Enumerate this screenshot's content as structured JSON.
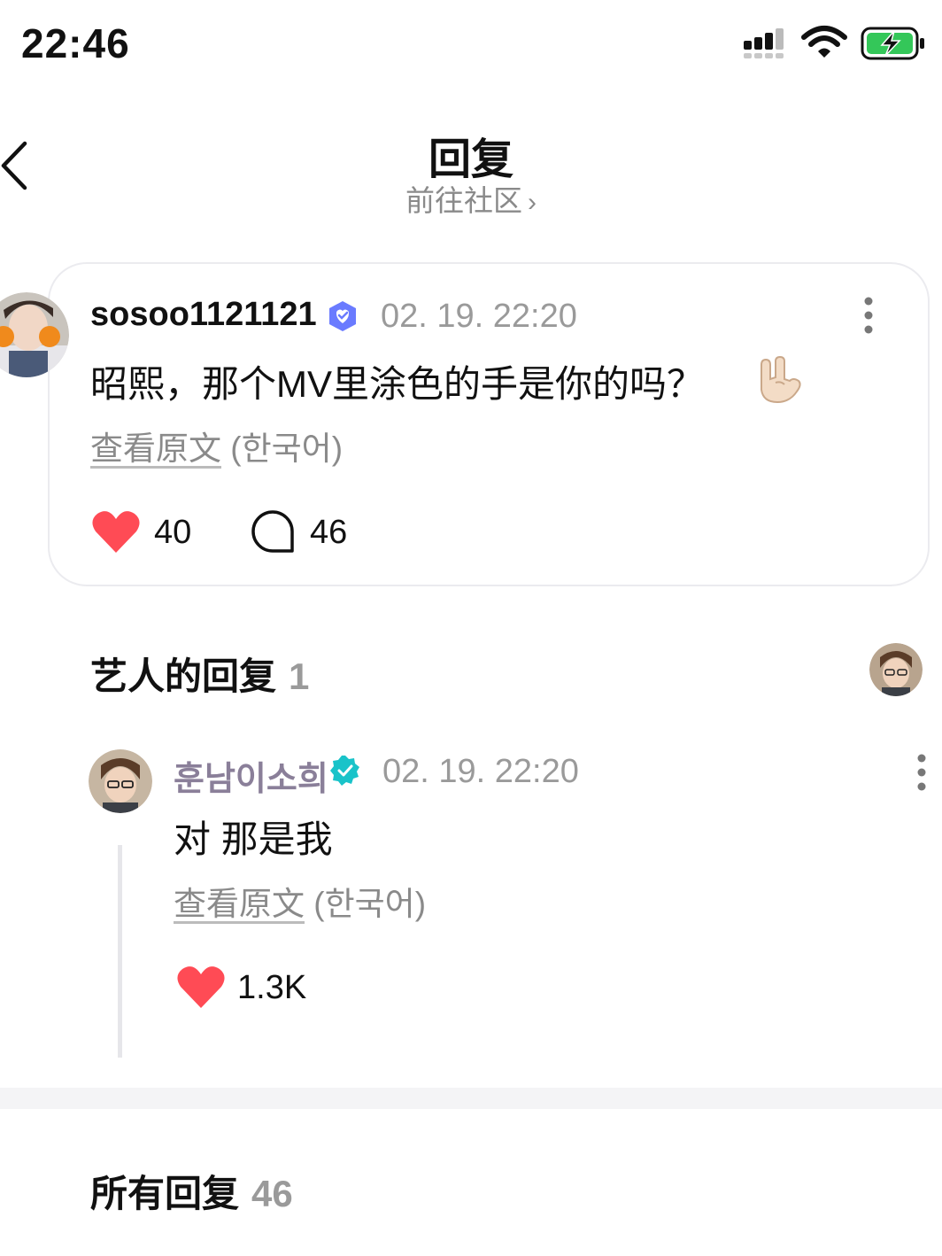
{
  "status_bar": {
    "time": "22:46",
    "accent": "#34c759"
  },
  "header": {
    "title": "回复",
    "subtitle": "前往社区",
    "chevron": "›"
  },
  "post": {
    "username": "sosoo1121121",
    "date": "02. 19. 22:20",
    "text": "昭熙，那个MV里涂色的手是你的吗？",
    "emoji": "hand-rock-emoji",
    "view_original": "查看原文",
    "language": "(한국어)",
    "likes": "40",
    "comments": "46"
  },
  "artist_section": {
    "title": "艺人的回复",
    "count": "1",
    "reply": {
      "name": "훈남이소희",
      "date": "02. 19. 22:20",
      "text": "对 那是我",
      "view_original": "查看原文",
      "language": "(한국어)",
      "likes": "1.3K"
    }
  },
  "all_section": {
    "title": "所有回复",
    "count": "46"
  },
  "colors": {
    "heart": "#ff4b55",
    "verified_blue": "#6a7bff",
    "verified_teal": "#19c3c9",
    "artist_name": "#8a7f99"
  }
}
